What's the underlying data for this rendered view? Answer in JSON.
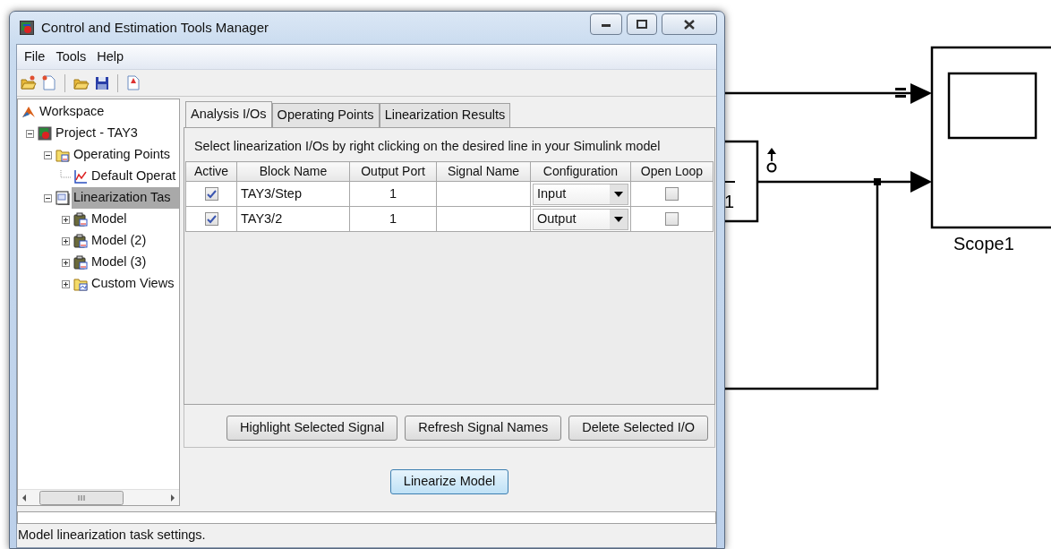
{
  "window": {
    "title": "Control and Estimation Tools Manager"
  },
  "menu": [
    "File",
    "Tools",
    "Help"
  ],
  "tree": [
    {
      "label": "Workspace",
      "kind": "workspace",
      "selected": false,
      "children": [
        {
          "label": "Project - TAY3",
          "kind": "project",
          "selected": false,
          "expanded": true,
          "children": [
            {
              "label": "Operating Points",
              "kind": "folder",
              "selected": false,
              "expanded": true,
              "children": [
                {
                  "label": "Default Operat",
                  "kind": "plot",
                  "selected": false
                }
              ]
            },
            {
              "label": "Linearization Tas",
              "kind": "task",
              "selected": true,
              "expanded": true,
              "children": [
                {
                  "label": "Model",
                  "kind": "model",
                  "selected": false,
                  "expanded": false
                },
                {
                  "label": "Model (2)",
                  "kind": "model",
                  "selected": false,
                  "expanded": false
                },
                {
                  "label": "Model (3)",
                  "kind": "model",
                  "selected": false,
                  "expanded": false
                },
                {
                  "label": "Custom Views",
                  "kind": "views",
                  "selected": false,
                  "expanded": false
                }
              ]
            }
          ]
        }
      ]
    }
  ],
  "tabs": [
    {
      "label": "Analysis I/Os",
      "selected": true
    },
    {
      "label": "Operating Points",
      "selected": false
    },
    {
      "label": "Linearization Results",
      "selected": false
    }
  ],
  "instruction": "Select linearization I/Os by right clicking on the desired line in your Simulink model",
  "table": {
    "columns": [
      "Active",
      "Block Name",
      "Output Port",
      "Signal Name",
      "Configuration",
      "Open Loop"
    ],
    "rows": [
      {
        "active": true,
        "block_name": "TAY3/Step",
        "output_port": "1",
        "configuration": "Input",
        "open_loop": false
      },
      {
        "active": true,
        "block_name": "TAY3/2",
        "output_port": "1",
        "configuration": "Output",
        "open_loop": false
      }
    ]
  },
  "buttons": [
    "Highlight Selected Signal",
    "Refresh Signal Names",
    "Delete Selected I/O"
  ],
  "primary_button": "Linearize Model",
  "status_bar": "Model linearization task settings.",
  "diagram": {
    "block_label": "1",
    "scope_label": "Scope1"
  }
}
